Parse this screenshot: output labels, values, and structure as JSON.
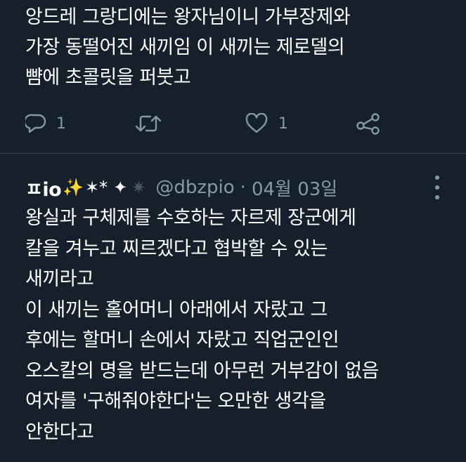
{
  "tweet1": {
    "lines": [
      "앙드레 그랑디에는 왕자님이니 가부장제와",
      "가장 동떨어진 새끼임 이 새끼는 제로델의",
      "뺨에 초콜릿을 퍼붓고"
    ],
    "actions": {
      "reply_count": "1",
      "retweet_count": "",
      "like_count": "1",
      "icons": [
        "reply-icon",
        "retweet-icon",
        "like-icon",
        "share-icon"
      ]
    }
  },
  "tweet2": {
    "display_name": "ㅍio",
    "name_emojis": [
      "✨",
      "✶*",
      "✦",
      "✷"
    ],
    "handle": "@dbzpio",
    "separator": "·",
    "date": "04월 03일",
    "lines": [
      "왕실과 구체제를 수호하는 자르제 장군에게",
      "칼을 겨누고 찌르겠다고 협박할 수 있는",
      "새끼라고",
      "이 새끼는 홀어머니 아래에서 자랐고 그",
      "후에는 할머니 손에서 자랐고 직업군인인",
      "오스칼의 명을 받드는데 아무런 거부감이 없음",
      "여자를 '구해줘야한다'는 오만한 생각을",
      "안한다고"
    ]
  },
  "colors": {
    "background": "#15202b",
    "text": "#ffffff",
    "secondary": "#8899a6",
    "divider": "#38444d"
  }
}
